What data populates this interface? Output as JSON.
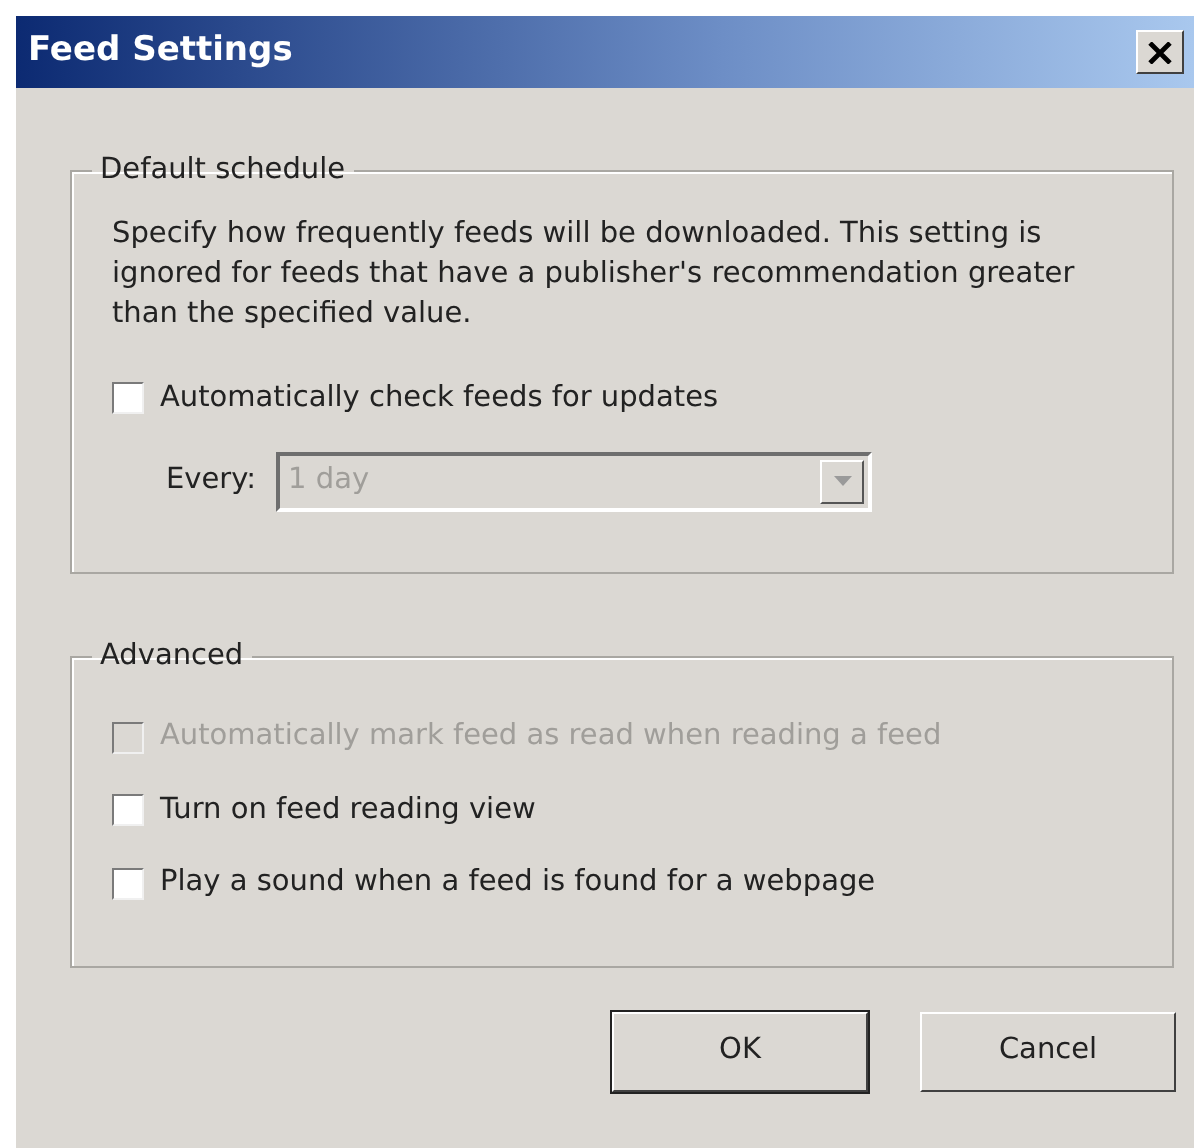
{
  "window": {
    "title": "Feed Settings"
  },
  "groups": [
    {
      "title": "Default schedule",
      "description": "Specify how frequently feeds will be downloaded. This setting is ignored for feeds that have a publisher's recommendation greater than the specified value.",
      "options": [
        {
          "label": "Automatically check feeds for updates",
          "checked": false,
          "disabled": false
        }
      ],
      "every": {
        "label": "Every:",
        "value": "1 day",
        "disabled": true
      }
    },
    {
      "title": "Advanced",
      "options": [
        {
          "label": "Automatically mark feed as read when reading a feed",
          "checked": false,
          "disabled": true
        },
        {
          "label": "Turn on feed reading view",
          "checked": false,
          "disabled": false
        },
        {
          "label": "Play a sound when a feed is found for a webpage",
          "checked": false,
          "disabled": false
        }
      ]
    }
  ],
  "buttons": [
    {
      "label": "OK",
      "default": true
    },
    {
      "label": "Cancel",
      "default": false
    }
  ]
}
